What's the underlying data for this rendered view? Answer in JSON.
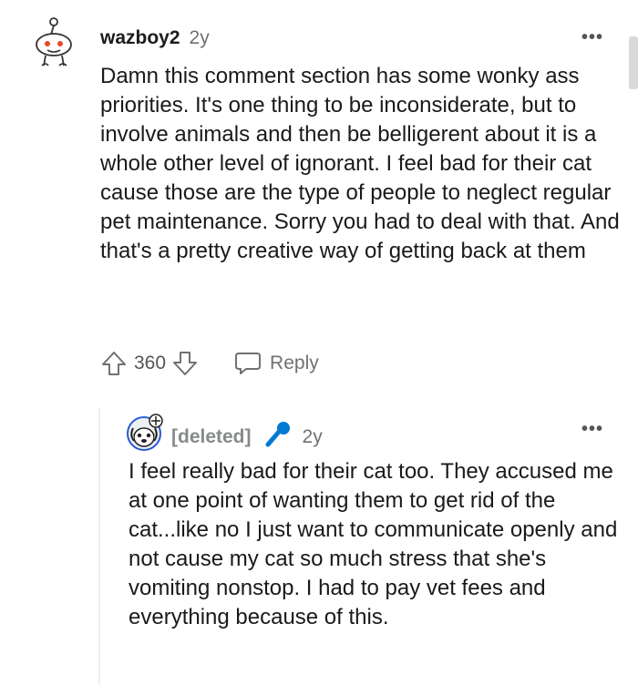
{
  "comments": [
    {
      "username": "wazboy2",
      "age": "2y",
      "avatar_icon": "reddit-snoo-avatar-icon",
      "more_label": "•••",
      "body": "Damn this comment section has some wonky ass priorities. It's one thing to be inconsiderate, but to involve animals and then be belligerent about it is a whole other level of ignorant. I feel bad for their cat cause those are the type of people to neglect regular pet maintenance. Sorry you had to deal with that. And that's a pretty creative way of getting back at them",
      "score": "360",
      "reply_label": "Reply"
    },
    {
      "username": "[deleted]",
      "age": "2y",
      "avatar_icon": "dog-snoo-avatar-icon",
      "flair_icon": "microphone-icon",
      "more_label": "•••",
      "body": "I feel really bad for their cat too. They accused me at one point of wanting them to get rid of the cat...like no I just want to communicate openly and not cause my cat so much stress that she's vomiting nonstop. I had to pay vet fees and everything because of this."
    }
  ],
  "colors": {
    "text": "#1c1c1c",
    "muted": "#6f7173",
    "deleted": "#878a8c",
    "mic": "#0079d3"
  }
}
